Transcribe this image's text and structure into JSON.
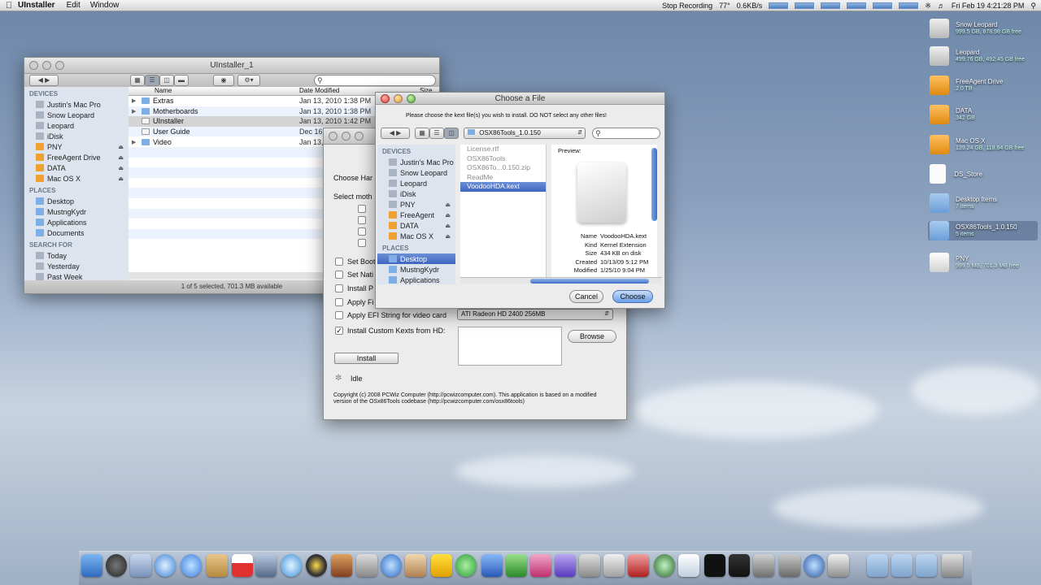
{
  "menubar": {
    "app_name": "UInstaller",
    "items": [
      "Edit",
      "Window"
    ],
    "recording": "Stop Recording",
    "temperature": "77°",
    "net_rates": "0.6KB/s",
    "clock": "Fri Feb 19  4:21:28 PM"
  },
  "finder": {
    "title": "UInstaller_1",
    "columns": {
      "name": "Name",
      "date": "Date Modified",
      "size": "Size"
    },
    "rows": [
      {
        "name": "Extras",
        "date": "Jan 13, 2010 1:38 PM",
        "kind": "folder"
      },
      {
        "name": "Motherboards",
        "date": "Jan 13, 2010 1:38 PM",
        "kind": "folder"
      },
      {
        "name": "UInstaller",
        "date": "Jan 13, 2010 1:42 PM",
        "kind": "doc"
      },
      {
        "name": "User Guide",
        "date": "Dec 16,",
        "kind": "doc"
      },
      {
        "name": "Video",
        "date": "Jan 13,",
        "kind": "folder"
      }
    ],
    "devices_header": "DEVICES",
    "devices": [
      "Justin's Mac Pro",
      "Snow Leopard",
      "Leopard",
      "iDisk",
      "PNY",
      "FreeAgent Drive",
      "DATA",
      "Mac OS X"
    ],
    "places_header": "PLACES",
    "places": [
      "Desktop",
      "MustngKydr",
      "Applications",
      "Documents"
    ],
    "search_header": "SEARCH FOR",
    "search_for": [
      "Today",
      "Yesterday",
      "Past Week"
    ],
    "status": "1 of 5 selected, 701.3 MB available"
  },
  "installer": {
    "partial_labels": [
      "Choose Har",
      "Select moth",
      "Set Boot",
      "Set Nati",
      "Install P",
      "Apply Fi"
    ],
    "efi_label": "Apply EFI String for video card",
    "efi_value": "ATI Radeon HD 2400 256MB",
    "kexts_label": "Install Custom Kexts from HD:",
    "browse": "Browse",
    "install": "Install",
    "status": "Idle",
    "copyright_1": "Copyright (c) 2008 PCWiz Computer (http://pcwizcomputer.com). This application is based on a modified",
    "copyright_2": "version of the OSx86Tools codebase (http://pcwizcomputer.com/osx86tools)"
  },
  "dialog": {
    "title": "Choose a File",
    "message": "Please choose the kext file(s) you wish to install. DO NOT select any other files!",
    "path": "OSX86Tools_1.0.150",
    "devices_header": "DEVICES",
    "devices": [
      "Justin's Mac Pro",
      "Snow Leopard",
      "Leopard",
      "iDisk",
      "PNY",
      "FreeAgent",
      "DATA",
      "Mac OS X"
    ],
    "places_header": "PLACES",
    "places": [
      "Desktop",
      "MustngKydr",
      "Applications"
    ],
    "files": [
      "License.rtf",
      "OSX86Tools",
      "OSX86To...0.150.zip",
      "ReadMe",
      "VoodooHDA.kext"
    ],
    "preview_label": "Preview:",
    "preview": {
      "name_k": "Name",
      "name_v": "VoodooHDA.kext",
      "kind_k": "Kind",
      "kind_v": "Kernel Extension",
      "size_k": "Size",
      "size_v": "434 KB on disk",
      "created_k": "Created",
      "created_v": "10/13/09 5:12 PM",
      "modified_k": "Modified",
      "modified_v": "1/25/10 9:04 PM"
    },
    "cancel": "Cancel",
    "choose": "Choose"
  },
  "desktop_icons": [
    {
      "name": "Snow Leopard",
      "sub": "999.5 GB, 878.98 GB free"
    },
    {
      "name": "Leopard",
      "sub": "499.76 GB, 492.45 GB free"
    },
    {
      "name": "FreeAgent Drive",
      "sub": "2.0 TB"
    },
    {
      "name": "DATA",
      "sub": "342 GB"
    },
    {
      "name": "Mac OS X",
      "sub": "139.24 GB, 118.84 GB free"
    },
    {
      "name": ".DS_Store",
      "sub": ""
    },
    {
      "name": "Desktop Items",
      "sub": "7 items"
    },
    {
      "name": "OSX86Tools_1.0.150",
      "sub": "5 items"
    },
    {
      "name": "PNY",
      "sub": "999.5 MB, 701.3 MB free"
    }
  ],
  "colors": {
    "selection": "#3e66bf",
    "dialog_accent": "#6c9ee6"
  }
}
